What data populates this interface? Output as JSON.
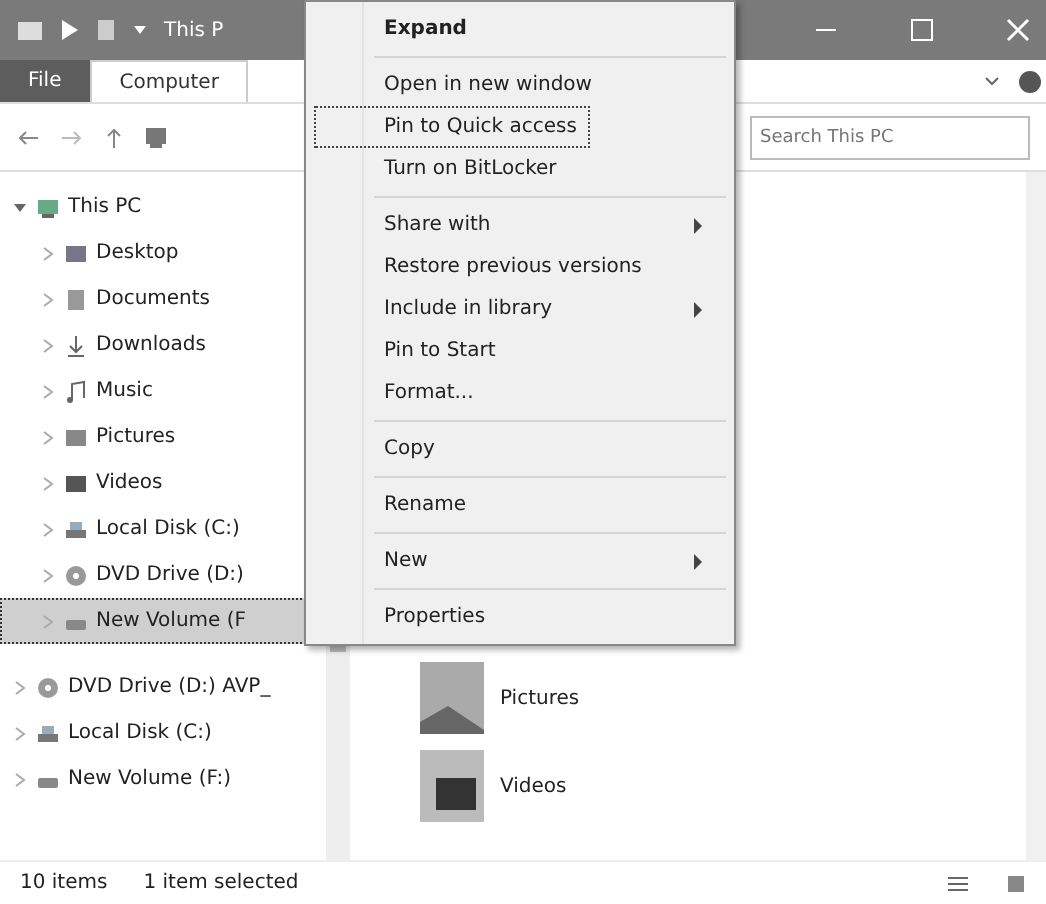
{
  "window": {
    "title": "This P"
  },
  "ribbon": {
    "tabs": [
      {
        "label": "File",
        "selected": false,
        "kind": "file"
      },
      {
        "label": "Computer",
        "selected": true,
        "kind": "tab"
      }
    ]
  },
  "address": {
    "search": {
      "placeholder": "Search This PC"
    }
  },
  "nav": [
    {
      "label": "This PC",
      "kind": "pc",
      "expanded": true,
      "selected": false,
      "children": [
        {
          "label": "Desktop",
          "kind": "desktop",
          "expanded": false,
          "selected": false
        },
        {
          "label": "Documents",
          "kind": "docs",
          "expanded": false,
          "selected": false
        },
        {
          "label": "Downloads",
          "kind": "downloads",
          "expanded": false,
          "selected": false
        },
        {
          "label": "Music",
          "kind": "music",
          "expanded": false,
          "selected": false
        },
        {
          "label": "Pictures",
          "kind": "pictures",
          "expanded": false,
          "selected": false
        },
        {
          "label": "Videos",
          "kind": "videos",
          "expanded": false,
          "selected": false
        },
        {
          "label": "Local Disk (C:)",
          "kind": "disk",
          "expanded": false,
          "selected": false
        },
        {
          "label": "DVD Drive (D:)",
          "kind": "dvd",
          "expanded": false,
          "selected": false
        },
        {
          "label": "New Volume (F",
          "kind": "volume",
          "expanded": false,
          "selected": true
        }
      ]
    },
    {
      "label": "DVD Drive (D:) AVP_",
      "kind": "dvd",
      "expanded": false,
      "selected": false
    },
    {
      "label": "Local Disk (C:)",
      "kind": "disk",
      "expanded": false,
      "selected": false
    },
    {
      "label": "New Volume (F:)",
      "kind": "volume",
      "expanded": false,
      "selected": false
    }
  ],
  "content": [
    {
      "label": "Pictures",
      "kind": "pictures"
    },
    {
      "label": "Videos",
      "kind": "videos"
    }
  ],
  "status_bar": [
    "10 items",
    "1 item selected"
  ],
  "context_menu": {
    "groups": [
      [
        {
          "label": "Expand",
          "default": true,
          "selected": false,
          "submenu": false
        }
      ],
      [
        {
          "label": "Open in new window",
          "default": false,
          "selected": false,
          "submenu": false
        },
        {
          "label": "Pin to Quick access",
          "default": false,
          "selected": true,
          "submenu": false
        },
        {
          "label": "Turn on BitLocker",
          "default": false,
          "selected": false,
          "submenu": false
        }
      ],
      [
        {
          "label": "Share with",
          "default": false,
          "selected": false,
          "submenu": true
        },
        {
          "label": "Restore previous versions",
          "default": false,
          "selected": false,
          "submenu": false
        },
        {
          "label": "Include in library",
          "default": false,
          "selected": false,
          "submenu": true
        },
        {
          "label": "Pin to Start",
          "default": false,
          "selected": false,
          "submenu": false
        },
        {
          "label": "Format...",
          "default": false,
          "selected": false,
          "submenu": false
        }
      ],
      [
        {
          "label": "Copy",
          "default": false,
          "selected": false,
          "submenu": false
        }
      ],
      [
        {
          "label": "Rename",
          "default": false,
          "selected": false,
          "submenu": false
        }
      ],
      [
        {
          "label": "New",
          "default": false,
          "selected": false,
          "submenu": true
        }
      ],
      [
        {
          "label": "Properties",
          "default": false,
          "selected": false,
          "submenu": false
        }
      ]
    ]
  }
}
